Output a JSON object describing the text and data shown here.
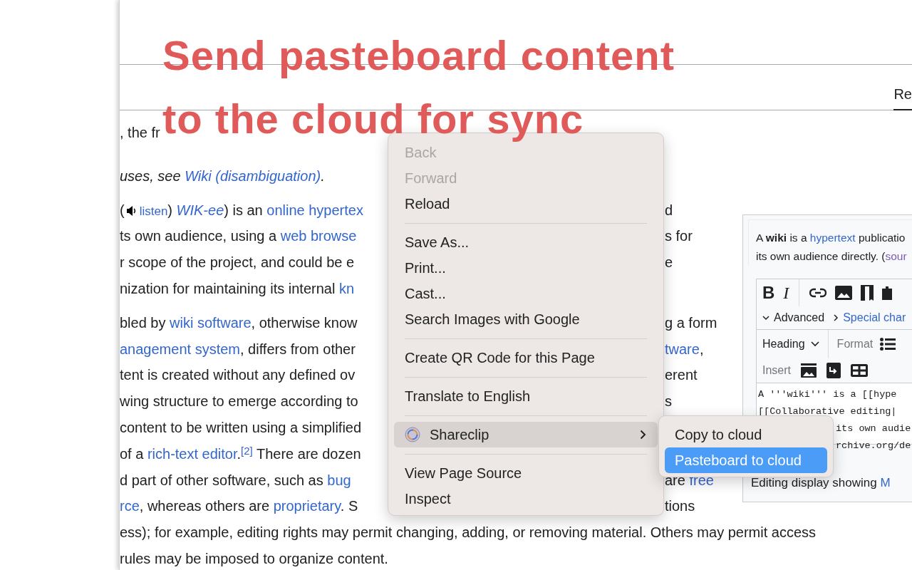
{
  "overlay_title": [
    "Send pasteboard content",
    "to the cloud for sync"
  ],
  "tabs": [
    {
      "label": "Re",
      "selected": true
    }
  ],
  "article": [
    {
      "kind": "tagline",
      "lines": [
        {
          "left": [
            {
              "kind": "text",
              "text": ", the fr"
            }
          ]
        }
      ]
    },
    {
      "kind": "hatnote",
      "lines": [
        {
          "left": [
            {
              "kind": "text",
              "text": "uses, see "
            },
            {
              "kind": "link",
              "text": "Wiki (disambiguation)"
            },
            {
              "kind": "text",
              "text": "."
            }
          ]
        }
      ]
    },
    {
      "kind": "body",
      "lines": [
        {
          "left": [
            {
              "kind": "text",
              "text": "("
            },
            {
              "kind": "listen",
              "text": "listen"
            },
            {
              "kind": "text",
              "text": ") "
            },
            {
              "kind": "italic_link",
              "text": "WIK-ee"
            },
            {
              "kind": "text",
              "text": ") is an "
            },
            {
              "kind": "link",
              "text": "online hypertex"
            }
          ],
          "right": [
            {
              "kind": "text",
              "text": "d"
            }
          ]
        },
        {
          "left": [
            {
              "kind": "text",
              "text": "ts own audience, using a "
            },
            {
              "kind": "link",
              "text": "web browse"
            }
          ],
          "right": [
            {
              "kind": "text",
              "text": "s for"
            }
          ]
        },
        {
          "left": [
            {
              "kind": "text",
              "text": "r scope of the project, and could be e"
            }
          ],
          "right": [
            {
              "kind": "text",
              "text": "e"
            }
          ]
        },
        {
          "left": [
            {
              "kind": "text",
              "text": "nization for maintaining its internal "
            },
            {
              "kind": "link",
              "text": "kn"
            }
          ]
        }
      ]
    },
    {
      "kind": "body",
      "lines": [
        {
          "left": [
            {
              "kind": "text",
              "text": "bled by "
            },
            {
              "kind": "link",
              "text": "wiki software"
            },
            {
              "kind": "text",
              "text": ", otherwise know"
            }
          ],
          "right": [
            {
              "kind": "text",
              "text": "g a form"
            }
          ]
        },
        {
          "left": [
            {
              "kind": "link",
              "text": "anagement system"
            },
            {
              "kind": "text",
              "text": ", differs from other"
            }
          ],
          "right": [
            {
              "kind": "link",
              "text": "tware"
            },
            {
              "kind": "text",
              "text": ","
            }
          ]
        },
        {
          "left": [
            {
              "kind": "text",
              "text": "tent is created without any defined ov"
            }
          ],
          "right": [
            {
              "kind": "text",
              "text": "erent"
            }
          ]
        },
        {
          "left": [
            {
              "kind": "text",
              "text": "wing structure to emerge according to"
            }
          ],
          "right": [
            {
              "kind": "text",
              "text": "s"
            }
          ]
        },
        {
          "left": [
            {
              "kind": "text",
              "text": "content to be written using a simplified"
            }
          ]
        },
        {
          "left": [
            {
              "kind": "text",
              "text": "of a "
            },
            {
              "kind": "link",
              "text": "rich-text editor"
            },
            {
              "kind": "rich",
              "text": ".$^{[2]}$ There are dozen"
            }
          ]
        },
        {
          "left": [
            {
              "kind": "text",
              "text": "d part of other software, such as "
            },
            {
              "kind": "link",
              "text": "bug"
            }
          ],
          "right": [
            {
              "kind": "text",
              "text": "are "
            },
            {
              "kind": "link",
              "text": "free"
            }
          ]
        },
        {
          "left": [
            {
              "kind": "link",
              "text": "rce"
            },
            {
              "kind": "text",
              "text": ", whereas others are "
            },
            {
              "kind": "link",
              "text": "proprietary"
            },
            {
              "kind": "text",
              "text": ". S"
            }
          ],
          "right": [
            {
              "kind": "text",
              "text": "tions"
            }
          ]
        },
        {
          "left": [
            {
              "kind": "text",
              "text": "ess); for example, editing rights may permit changing, adding, or removing material. Others may permit access"
            }
          ]
        },
        {
          "left": [
            {
              "kind": "text",
              "text": "rules may be imposed to organize content."
            }
          ]
        }
      ]
    }
  ],
  "infobox": {
    "intro": [
      [
        {
          "kind": "text",
          "text": "A "
        },
        {
          "kind": "bold",
          "text": "wiki"
        },
        {
          "kind": "text",
          "text": " is a "
        },
        {
          "kind": "link",
          "text": "hypertext"
        },
        {
          "kind": "text",
          "text": " publicatio"
        }
      ],
      [
        {
          "kind": "text",
          "text": "its own audience directly. ("
        },
        {
          "kind": "visited_link",
          "text": "sour"
        }
      ]
    ],
    "format_buttons": [
      "B",
      "I"
    ],
    "advanced": "Advanced",
    "special": "Special char",
    "heading": "Heading",
    "format": "Format",
    "insert": "Insert",
    "editor_lines": [
      "A '''wiki''' is a [[hype",
      "[[Collaborative editing|",
      "its own audie",
      "rchive.org/de"
    ],
    "caption": {
      "text": "Editing display showing ",
      "link": "M"
    }
  },
  "context_menu": {
    "items": [
      {
        "kind": "item",
        "label": "Back",
        "disabled": true
      },
      {
        "kind": "item",
        "label": "Forward",
        "disabled": true
      },
      {
        "kind": "item",
        "label": "Reload",
        "disabled": false
      },
      {
        "kind": "separator"
      },
      {
        "kind": "item",
        "label": "Save As...",
        "disabled": false
      },
      {
        "kind": "item",
        "label": "Print...",
        "disabled": false
      },
      {
        "kind": "item",
        "label": "Cast...",
        "disabled": false
      },
      {
        "kind": "item",
        "label": "Search Images with Google",
        "disabled": false
      },
      {
        "kind": "separator"
      },
      {
        "kind": "item",
        "label": "Create QR Code for this Page",
        "disabled": false
      },
      {
        "kind": "separator"
      },
      {
        "kind": "item",
        "label": "Translate to English",
        "disabled": false
      },
      {
        "kind": "separator"
      },
      {
        "kind": "submenu",
        "label": "Shareclip",
        "selected": true
      },
      {
        "kind": "separator"
      },
      {
        "kind": "item",
        "label": "View Page Source",
        "disabled": false
      },
      {
        "kind": "item",
        "label": "Inspect",
        "disabled": false
      }
    ]
  },
  "submenu": {
    "items": [
      {
        "label": "Copy to cloud",
        "selected": false
      },
      {
        "label": "Pasteboard to cloud",
        "selected": true
      }
    ]
  }
}
